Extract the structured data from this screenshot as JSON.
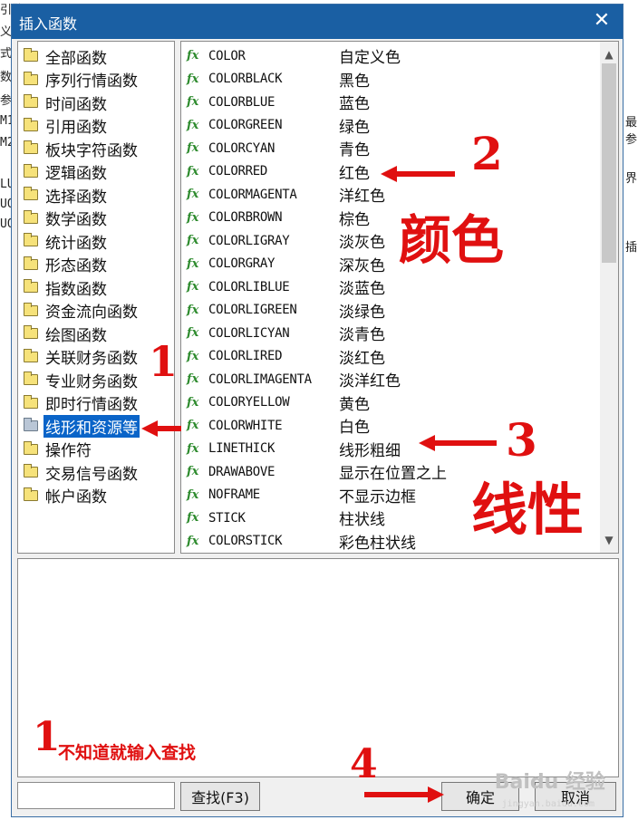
{
  "dialog": {
    "title": "插入函数",
    "close_symbol": "✕"
  },
  "categories": [
    "全部函数",
    "序列行情函数",
    "时间函数",
    "引用函数",
    "板块字符函数",
    "逻辑函数",
    "选择函数",
    "数学函数",
    "统计函数",
    "形态函数",
    "指数函数",
    "资金流向函数",
    "绘图函数",
    "关联财务函数",
    "专业财务函数",
    "即时行情函数",
    "线形和资源等",
    "操作符",
    "交易信号函数",
    "帐户函数"
  ],
  "selected_category_index": 16,
  "functions": [
    {
      "name": "COLOR",
      "desc": "自定义色"
    },
    {
      "name": "COLORBLACK",
      "desc": "黑色"
    },
    {
      "name": "COLORBLUE",
      "desc": "蓝色"
    },
    {
      "name": "COLORGREEN",
      "desc": "绿色"
    },
    {
      "name": "COLORCYAN",
      "desc": "青色"
    },
    {
      "name": "COLORRED",
      "desc": "红色"
    },
    {
      "name": "COLORMAGENTA",
      "desc": "洋红色"
    },
    {
      "name": "COLORBROWN",
      "desc": "棕色"
    },
    {
      "name": "COLORLIGRAY",
      "desc": "淡灰色"
    },
    {
      "name": "COLORGRAY",
      "desc": "深灰色"
    },
    {
      "name": "COLORLIBLUE",
      "desc": "淡蓝色"
    },
    {
      "name": "COLORLIGREEN",
      "desc": "淡绿色"
    },
    {
      "name": "COLORLICYAN",
      "desc": "淡青色"
    },
    {
      "name": "COLORLIRED",
      "desc": "淡红色"
    },
    {
      "name": "COLORLIMAGENTA",
      "desc": "淡洋红色"
    },
    {
      "name": "COLORYELLOW",
      "desc": "黄色"
    },
    {
      "name": "COLORWHITE",
      "desc": "白色"
    },
    {
      "name": "LINETHICK",
      "desc": "线形粗细"
    },
    {
      "name": "DRAWABOVE",
      "desc": "显示在位置之上"
    },
    {
      "name": "NOFRAME",
      "desc": "不显示边框"
    },
    {
      "name": "STICK",
      "desc": "柱状线"
    },
    {
      "name": "COLORSTICK",
      "desc": "彩色柱状线"
    }
  ],
  "fx_label": "fx",
  "search": {
    "value": "",
    "button_label": "查找(F3)"
  },
  "buttons": {
    "ok": "确定",
    "cancel": "取消"
  },
  "annotations": {
    "n1": "1",
    "n2": "2",
    "n3": "3",
    "n4": "4",
    "color_label": "颜色",
    "line_label": "线性",
    "hint_number": "1",
    "hint_text": "不知道就输入查找"
  },
  "background_fragments": [
    "引擎",
    "义t",
    "式损",
    "数",
    "参",
    "M1",
    "M2",
    "LU",
    "UO",
    "UO",
    "最参",
    "界",
    "插"
  ],
  "watermark": "Baidu 经验",
  "watermark_sub": "jingyan.baidu.com",
  "colors": {
    "title_bar": "#1a5fa3",
    "selection": "#0a64c8",
    "fx_icon": "#2e8b2e",
    "annotation": "#e01010"
  }
}
